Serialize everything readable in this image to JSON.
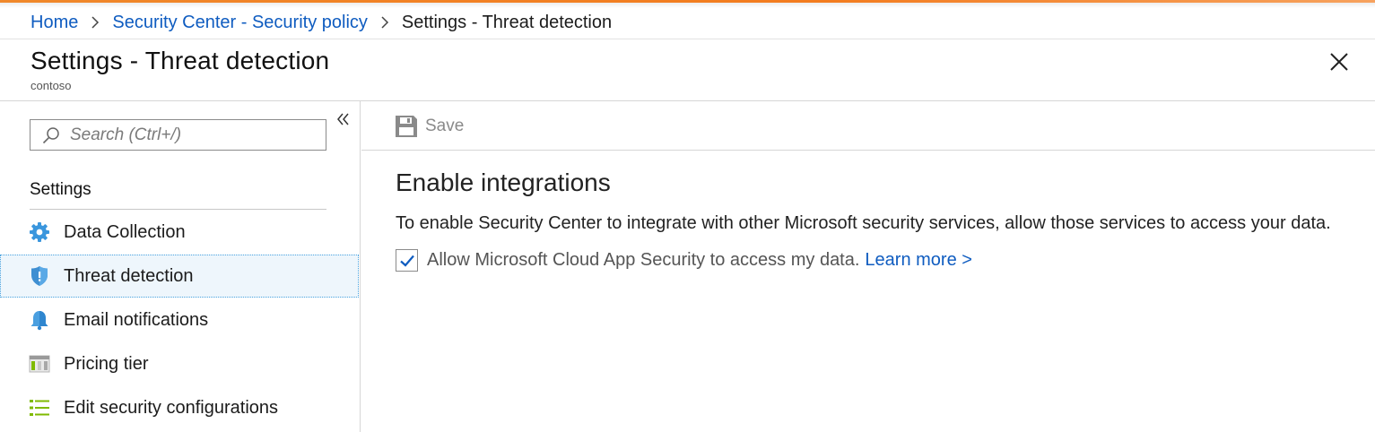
{
  "breadcrumb": {
    "items": [
      {
        "label": "Home"
      },
      {
        "label": "Security Center - Security policy"
      },
      {
        "label": "Settings - Threat detection"
      }
    ]
  },
  "blade": {
    "title": "Settings - Threat detection",
    "subtitle": "contoso"
  },
  "search": {
    "placeholder": "Search (Ctrl+/)",
    "value": ""
  },
  "nav": {
    "group_label": "Settings",
    "items": [
      {
        "label": "Data Collection",
        "icon": "gear-icon",
        "selected": false
      },
      {
        "label": "Threat detection",
        "icon": "shield-icon",
        "selected": true
      },
      {
        "label": "Email notifications",
        "icon": "bell-icon",
        "selected": false
      },
      {
        "label": "Pricing tier",
        "icon": "pricing-icon",
        "selected": false
      },
      {
        "label": "Edit security configurations",
        "icon": "list-icon",
        "selected": false
      }
    ]
  },
  "toolbar": {
    "save_label": "Save",
    "save_enabled": false
  },
  "main": {
    "section_title": "Enable integrations",
    "description": "To enable Security Center to integrate with other Microsoft security services, allow those services to access your data.",
    "checkbox_label": "Allow Microsoft Cloud App Security to access my data.",
    "checkbox_checked": true,
    "learn_more": "Learn more >"
  },
  "colors": {
    "accent_orange": "#f37c1f",
    "link_blue": "#0f5cc0",
    "selected_bg": "#eef6fc",
    "check_blue": "#0f5cc0"
  }
}
